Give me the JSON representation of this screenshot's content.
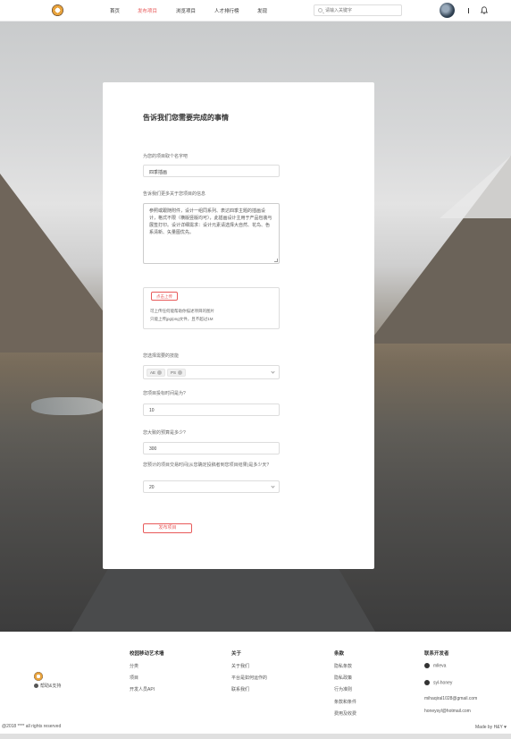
{
  "header": {
    "nav": [
      "首页",
      "发布项目",
      "浏览项目",
      "人才排行榜",
      "发现"
    ],
    "active_index": 1,
    "search_placeholder": "请输入关键字"
  },
  "form": {
    "title": "告诉我们您需要完成的事情",
    "name_label": "为您的项目取个名字吧",
    "name_value": "四季插画",
    "desc_label": "告诉我们更多关于您项目的信息",
    "desc_value": "参照或跟随附件，设计一组同系列、表达四季主题的插画设计，格式不限（横版竖版均可），此插画设计主用于产品包装与展签打印。设计详细需求：设计元素请选择大自然、花鸟、色系清新、矢量图优先。",
    "upload_button": "点击上传",
    "upload_hint_1": "可上传任何能帮助你描述项目的图片",
    "upload_hint_2": "只能上传jpg/png文件，且不超过1M",
    "skills_label": "您选择需要的技能",
    "skills": [
      "AE",
      "PS"
    ],
    "days_label": "您项目投标时间是为?",
    "days_value": "10",
    "budget_label": "您大致的预算是多少?",
    "budget_value": "300",
    "wait_label": "您预计的项目交易时间(从您确定投稿者到您项目结果)是多少天?",
    "wait_value": "20",
    "submit": "发布项目"
  },
  "footer": {
    "help": "帮助&支持",
    "col1": {
      "head": "校园移动艺术墙",
      "links": [
        "分类",
        "项目",
        "开发人员API"
      ]
    },
    "col2": {
      "head": "关于",
      "links": [
        "关于我们",
        "平台是如何运作的",
        "联系我们"
      ]
    },
    "col3": {
      "head": "条款",
      "links": [
        "隐私条款",
        "隐私政策",
        "行为准则",
        "条款和条件",
        "费用及收费"
      ]
    },
    "col4": {
      "head": "联系开发者",
      "links": [
        "mlleva",
        "syl-honey",
        "mihaqiral1028@gmail.com",
        "honeysyl@hotmail.com"
      ]
    },
    "copyright": "@2018 **** all rights reserved",
    "made_by": "Made by H&Y ♥"
  }
}
